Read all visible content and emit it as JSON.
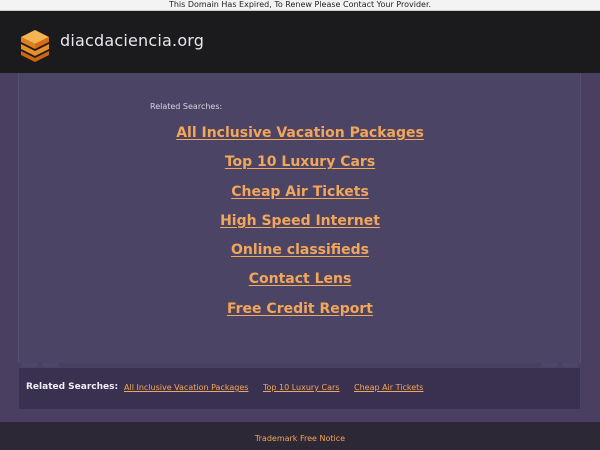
{
  "banner": {
    "text": "This Domain Has Expired, To Renew Please Contact Your Provider."
  },
  "header": {
    "site_name": "diacdaciencia.org",
    "logo_icon": "stacked-layers-logo-icon"
  },
  "main": {
    "related_label": "Related Searches:",
    "links": [
      "All Inclusive Vacation Packages",
      "Top 10 Luxury Cars",
      "Cheap Air Tickets",
      "High Speed Internet",
      "Online classifieds",
      "Contact Lens",
      "Free Credit Report"
    ]
  },
  "bottom": {
    "label": "Related Searches:",
    "links": [
      "All Inclusive Vacation Packages",
      "Top 10 Luxury Cars",
      "Cheap Air Tickets"
    ]
  },
  "footer": {
    "link": "Trademark Free Notice"
  },
  "colors": {
    "accent": "#f2a65a",
    "header_bg": "#1b1b1d",
    "panel_bg": "#4c4465",
    "bottom_bar_bg": "#3a3150"
  }
}
